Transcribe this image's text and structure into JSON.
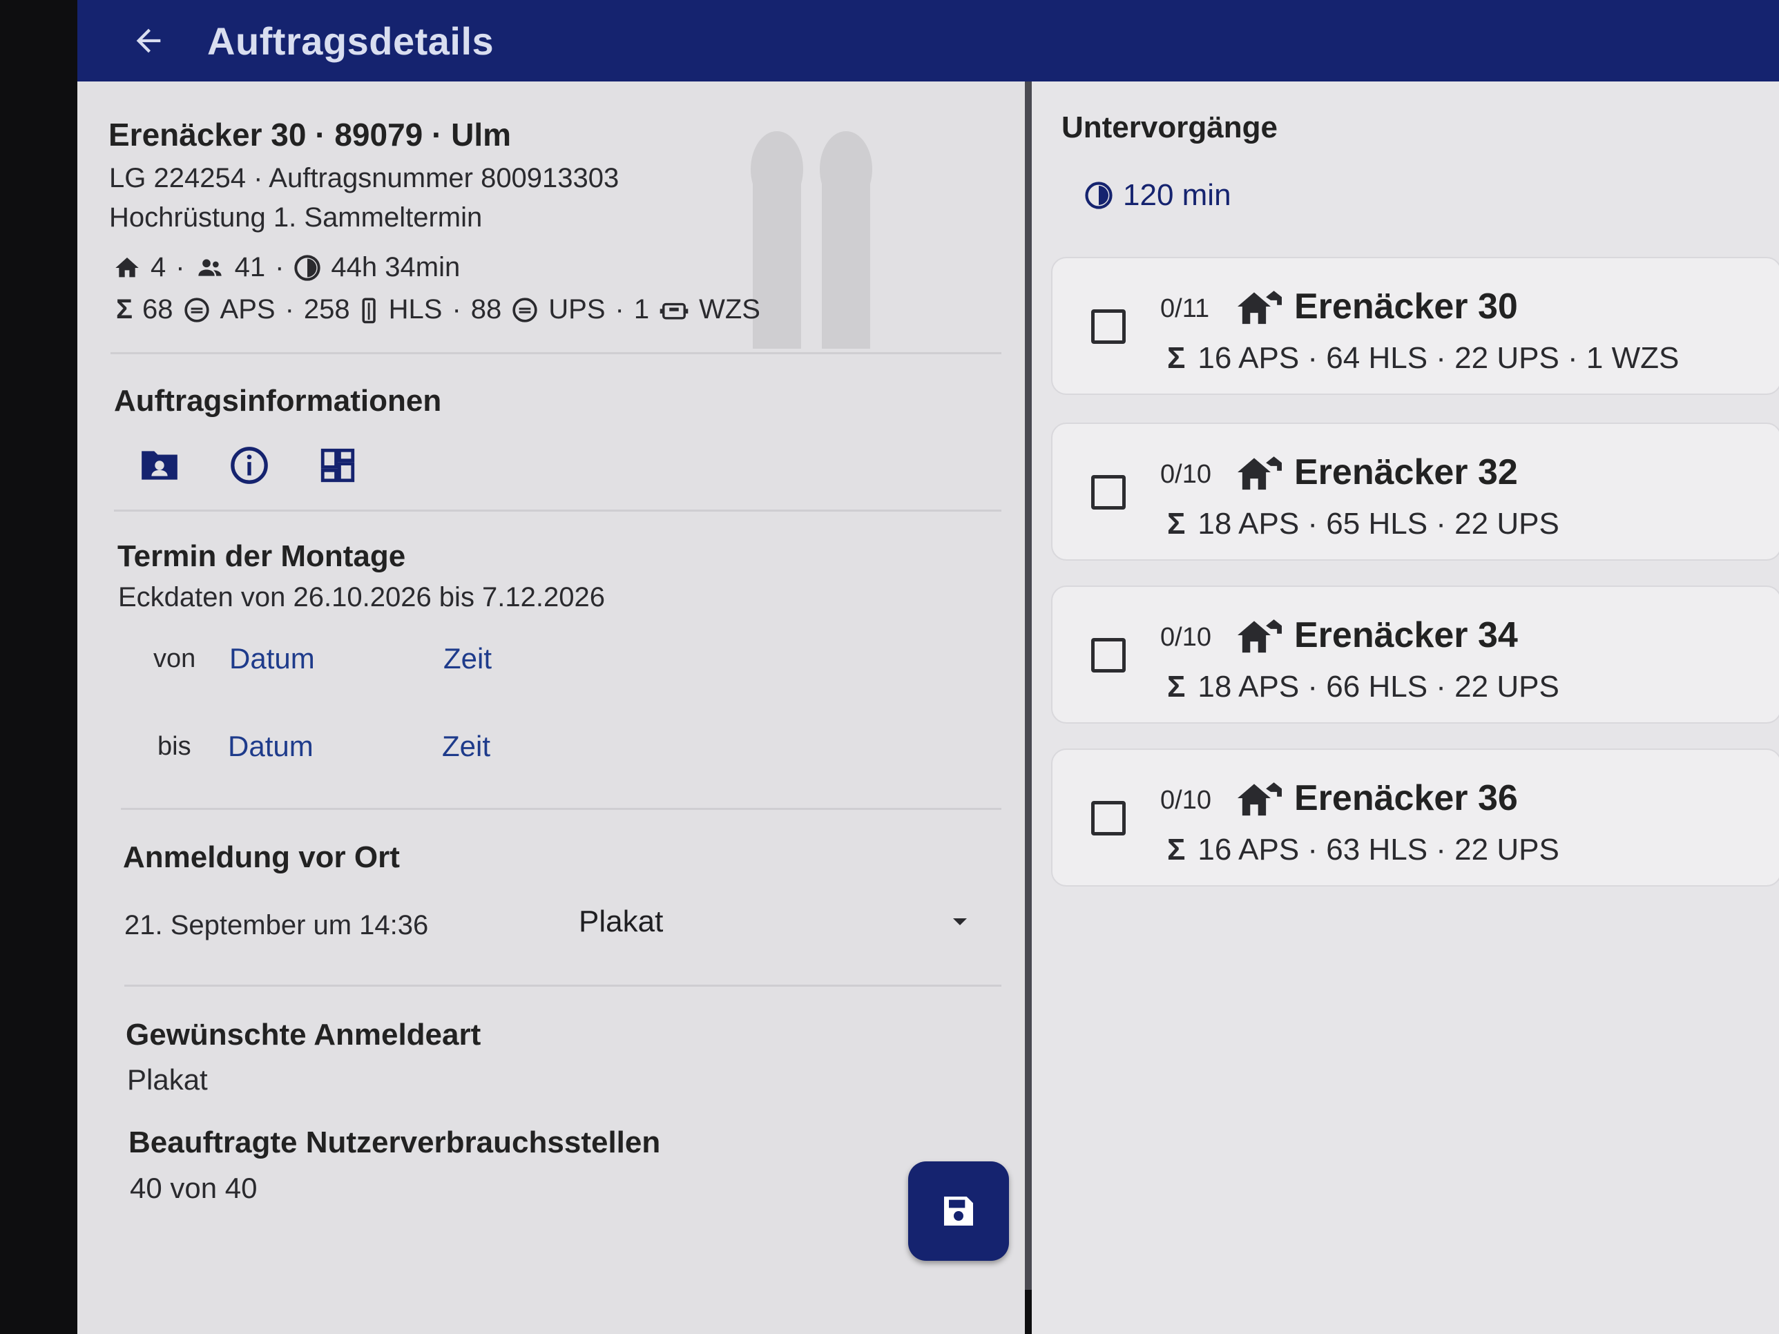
{
  "appbar": {
    "title": "Auftragsdetails",
    "back_icon": "arrow-left-icon"
  },
  "header": {
    "address": "Erenäcker 30 · 89079 · Ulm",
    "order_line": "LG 224254 · Auftragsnummer 800913303",
    "job_type": "Hochrüstung 1. Sammeltermin",
    "houses": "4",
    "persons": "41",
    "duration": "44h 34min",
    "aps_count": "68",
    "aps_label": "APS",
    "hls_count": "258",
    "hls_label": "HLS",
    "ups_count": "88",
    "ups_label": "UPS",
    "wzs_count": "1",
    "wzs_label": "WZS"
  },
  "auftragsinfo": {
    "heading": "Auftragsinformationen",
    "icons": [
      "contact-folder-icon",
      "info-icon",
      "dashboard-icon"
    ]
  },
  "termin": {
    "heading": "Termin der Montage",
    "eckdaten": "Eckdaten von 26.10.2026 bis 7.12.2026",
    "from_label": "von",
    "to_label": "bis",
    "date_label": "Datum",
    "time_label": "Zeit"
  },
  "anmeldung": {
    "heading": "Anmeldung vor Ort",
    "date": "21. September um 14:36",
    "selected": "Plakat"
  },
  "gewuenscht": {
    "heading": "Gewünschte Anmeldeart",
    "value": "Plakat"
  },
  "beauftragt": {
    "heading": "Beauftragte Nutzerverbrauchsstellen",
    "value": "40 von 40"
  },
  "untervorgaenge": {
    "heading": "Untervorgänge",
    "duration": "120 min",
    "items": [
      {
        "count": "0/11",
        "name": "Erenäcker 30",
        "summary": "16 APS · 64 HLS · 22 UPS · 1 WZS"
      },
      {
        "count": "0/10",
        "name": "Erenäcker 32",
        "summary": "18 APS · 65 HLS · 22 UPS"
      },
      {
        "count": "0/10",
        "name": "Erenäcker 34",
        "summary": "18 APS · 66 HLS · 22 UPS"
      },
      {
        "count": "0/10",
        "name": "Erenäcker 36",
        "summary": "16 APS · 63 HLS · 22 UPS"
      }
    ]
  },
  "colors": {
    "primary": "#15236f",
    "link": "#1e3b8b",
    "panel_bg": "#e1e0e3"
  }
}
